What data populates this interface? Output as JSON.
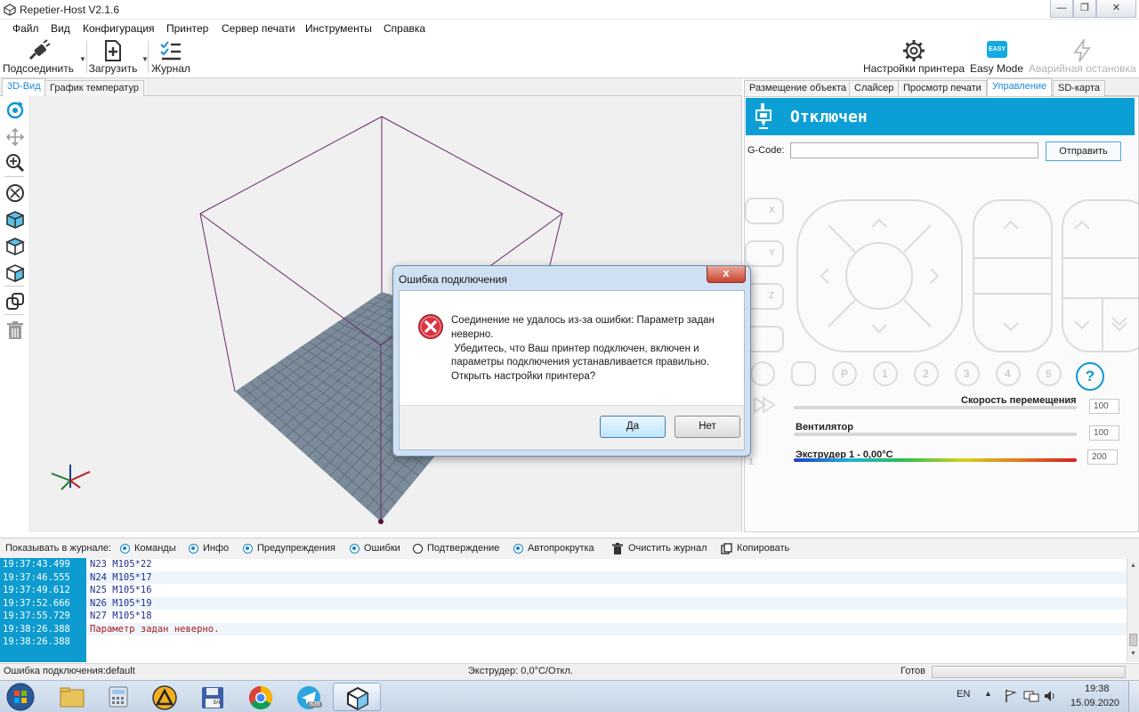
{
  "window": {
    "title": "Repetier-Host V2.1.6"
  },
  "menu": [
    "Файл",
    "Вид",
    "Конфигурация",
    "Принтер",
    "Сервер печати",
    "Инструменты",
    "Справка"
  ],
  "toolbar": {
    "connect": "Подсоединить",
    "load": "Загрузить",
    "log": "Журнал",
    "printer_settings": "Настройки принтера",
    "easy_mode": "Easy Mode",
    "easy_badge": "EASY",
    "emergency_stop": "Аварийная остановка"
  },
  "left_tabs": [
    "3D-Вид",
    "График температур"
  ],
  "right_tabs": [
    "Размещение объекта",
    "Слайсер",
    "Просмотр печати",
    "Управление",
    "SD-карта"
  ],
  "control": {
    "status": "Отключен",
    "gcode_label": "G-Code:",
    "gcode_value": "",
    "send_button": "Отправить",
    "home_x": "X",
    "home_y": "Y",
    "home_z": "Z",
    "preset_buttons": [
      "P",
      "1",
      "2",
      "3",
      "4",
      "5",
      "?"
    ],
    "speed_label": "Скорость перемещения",
    "speed_value": "100",
    "fan_label": "Вентилятор",
    "fan_value": "100",
    "extruder_label": "Экструдер 1 - 0,00°C",
    "extruder_value": "200",
    "extruder_index": "1"
  },
  "log_options": {
    "show_label": "Показывать в журнале:",
    "items": [
      {
        "label": "Команды",
        "checked": true
      },
      {
        "label": "Инфо",
        "checked": true
      },
      {
        "label": "Предупреждения",
        "checked": true
      },
      {
        "label": "Ошибки",
        "checked": true
      },
      {
        "label": "Подтверждение",
        "checked": false
      },
      {
        "label": "Автопрокрутка",
        "checked": true
      }
    ],
    "clear": "Очистить журнал",
    "copy": "Копировать"
  },
  "log": [
    {
      "time": "19:37:43.499",
      "text": "N23 M105*22"
    },
    {
      "time": "19:37:46.555",
      "text": "N24 M105*17"
    },
    {
      "time": "19:37:49.612",
      "text": "N25 M105*16"
    },
    {
      "time": "19:37:52.666",
      "text": "N26 M105*19"
    },
    {
      "time": "19:37:55.729",
      "text": "N27 M105*18"
    },
    {
      "time": "19:38:26.388",
      "text": "Параметр задан неверно."
    },
    {
      "time": "19:38:26.388",
      "text": ""
    }
  ],
  "statusbar": {
    "left": "Ошибка подключения:default",
    "middle": "Экструдер: 0,0°C/Откл.",
    "right": "Готов"
  },
  "dialog": {
    "title": "Ошибка подключения",
    "close": "x",
    "lines": [
      "Соединение не удалось из-за ошибки: Параметр задан",
      "неверно.",
      " Убедитесь, что Ваш принтер подключен, включен и",
      "параметры подключения устанавливается правильно.",
      "Открыть настройки принтера?"
    ],
    "yes": "Да",
    "no": "Нет"
  },
  "taskbar": {
    "lang": "EN",
    "time": "19:38",
    "date": "15.09.2020",
    "telegram_badge": "839",
    "calc_badge": "БЧ"
  },
  "colors": {
    "accent": "#0c9fd6",
    "plate": "#7a8a99",
    "error_text": "#a61c1c"
  }
}
